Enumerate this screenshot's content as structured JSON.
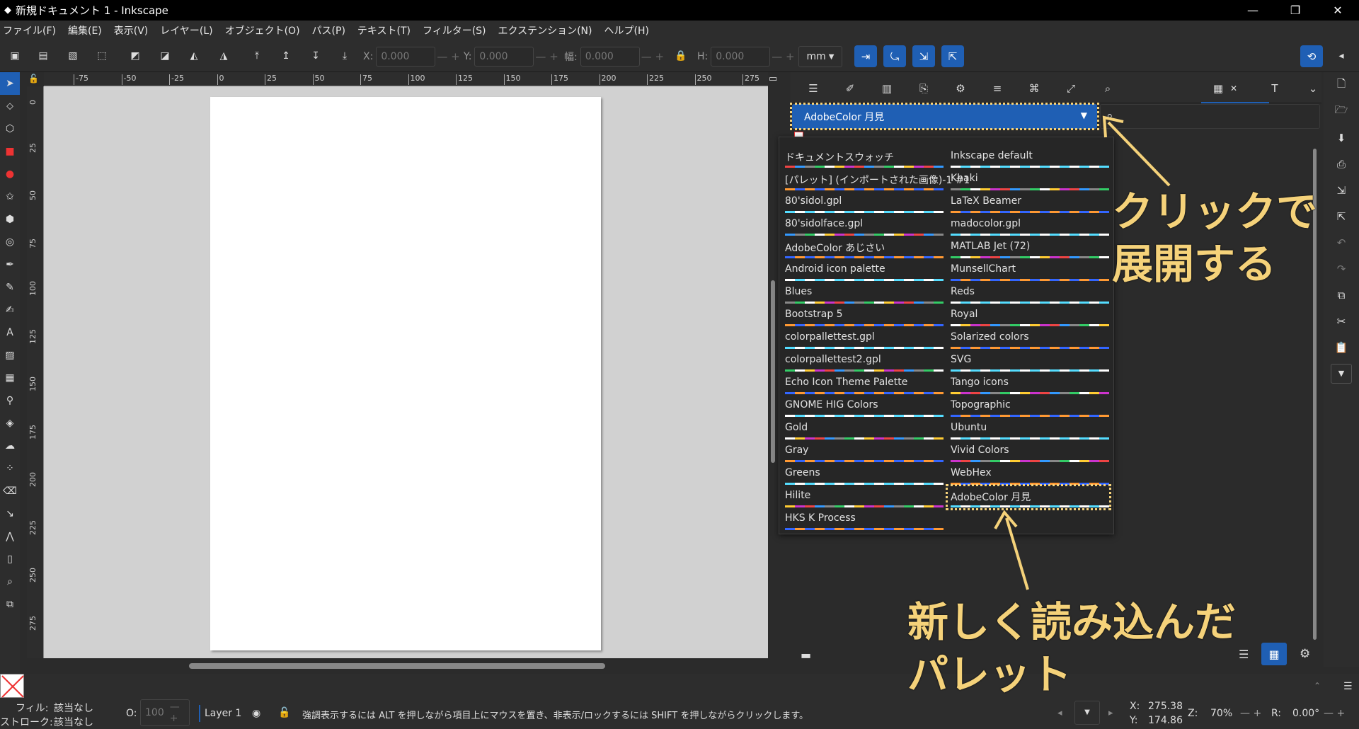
{
  "window": {
    "title": "新規ドキュメント 1 - Inkscape",
    "minimize": "—",
    "maximize": "❐",
    "close": "✕"
  },
  "menu": [
    "ファイル(F)",
    "編集(E)",
    "表示(V)",
    "レイヤー(L)",
    "オブジェクト(O)",
    "パス(P)",
    "テキスト(T)",
    "フィルター(S)",
    "エクステンション(N)",
    "ヘルプ(H)"
  ],
  "toolbar": {
    "x_label": "X:",
    "x_value": "0.000",
    "y_label": "Y:",
    "y_value": "0.000",
    "w_label": "幅:",
    "w_value": "0.000",
    "h_label": "H:",
    "h_value": "0.000",
    "unit": "mm",
    "pm": "— +"
  },
  "ruler_top": [
    "-75",
    "-50",
    "-25",
    "0",
    "25",
    "50",
    "75",
    "100",
    "125",
    "150",
    "175",
    "200",
    "225",
    "250",
    "275"
  ],
  "ruler_left": [
    "0",
    "25",
    "50",
    "75",
    "100",
    "125",
    "150",
    "175",
    "200",
    "225",
    "250",
    "275"
  ],
  "swatches": {
    "selected_palette": "AdobeColor 月見",
    "palettes_left": [
      "ドキュメントスウォッチ",
      "[パレット] (インポートされた画像)-1 #1",
      "80'sidol.gpl",
      "80'sidolface.gpl",
      "AdobeColor あじさい",
      "Android icon palette",
      "Blues",
      "Bootstrap 5",
      "colorpallettest.gpl",
      "colorpallettest2.gpl",
      "Echo Icon Theme Palette",
      "GNOME HIG Colors",
      "Gold",
      "Gray",
      "Greens",
      "Hilite",
      "HKS K Process"
    ],
    "palettes_right": [
      "Inkscape default",
      "Khaki",
      "LaTeX Beamer",
      "madocolor.gpl",
      "MATLAB Jet (72)",
      "MunsellChart",
      "Reds",
      "Royal",
      "Solarized colors",
      "SVG",
      "Tango icons",
      "Topographic",
      "Ubuntu",
      "Vivid Colors",
      "WebHex",
      "AdobeColor 月見"
    ]
  },
  "annotations": {
    "top_line1": "クリックで",
    "top_line2": "展開する",
    "bottom_line1": "新しく読み込んだ",
    "bottom_line2": "パレット"
  },
  "status": {
    "fill_label": "フィル:",
    "fill_value": "該当なし",
    "stroke_label": "ストローク:",
    "stroke_value": "該当なし",
    "opacity_label": "O:",
    "opacity_value": "100",
    "layer": "Layer 1",
    "message": "強調表示するには ALT を押しながら項目上にマウスを置き、非表示/ロックするには SHIFT を押しながらクリックします。",
    "x_label": "X:",
    "x_value": "275.38",
    "y_label": "Y:",
    "y_value": "174.86",
    "z_label": "Z:",
    "zoom": "70%",
    "r_label": "R:",
    "rotation": "0.00°"
  },
  "colors": {
    "accent": "#1f5fb4",
    "annotation": "#f5d27a"
  }
}
